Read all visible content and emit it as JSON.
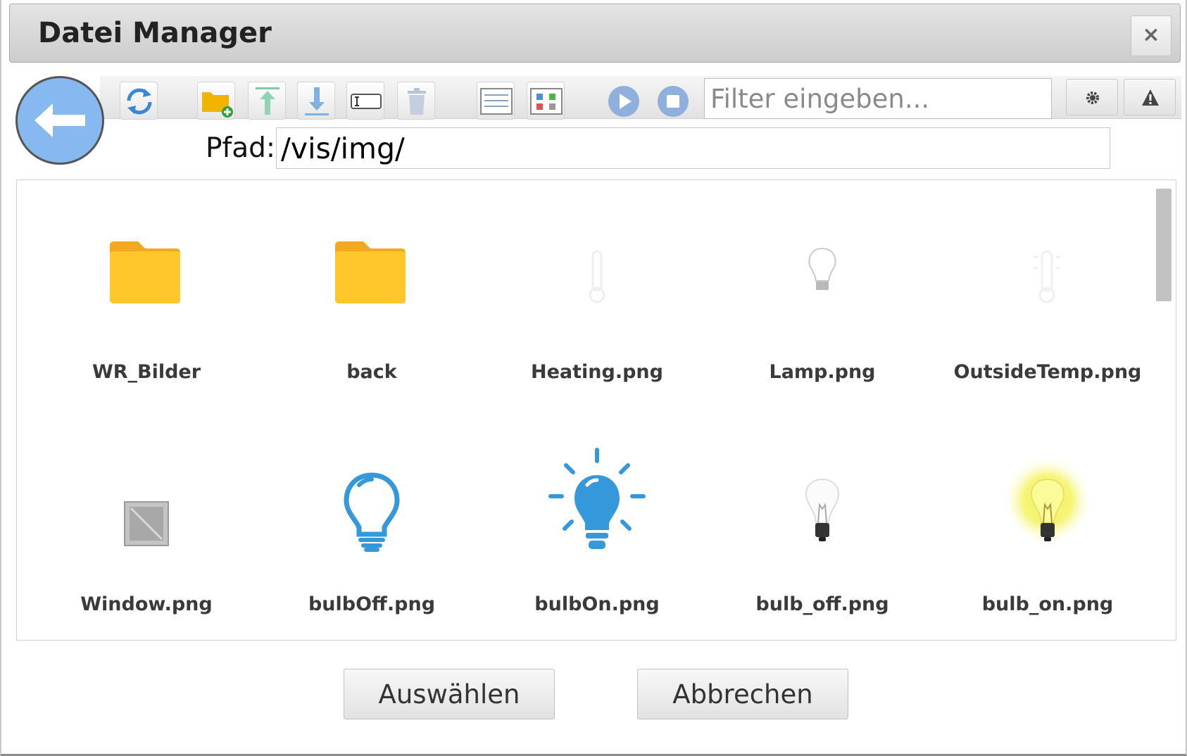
{
  "window": {
    "title": "Datei Manager",
    "close_glyph": "×"
  },
  "toolbar": {
    "icons": [
      "back-arrow-icon",
      "refresh-icon",
      "new-folder-icon",
      "upload-icon",
      "download-icon",
      "rename-icon",
      "delete-icon",
      "list-view-icon",
      "grid-view-icon",
      "play-icon",
      "stop-icon",
      "settings-icon",
      "warning-icon"
    ],
    "filter_placeholder": "Filter eingeben..."
  },
  "path": {
    "label": "Pfad:",
    "value": "/vis/img/"
  },
  "files": [
    {
      "name": "WR_Bilder",
      "icon": "folder-icon"
    },
    {
      "name": "back",
      "icon": "folder-icon"
    },
    {
      "name": "Heating.png",
      "icon": "thermometer-icon"
    },
    {
      "name": "Lamp.png",
      "icon": "lamp-icon"
    },
    {
      "name": "OutsideTemp.png",
      "icon": "outside-temp-icon"
    },
    {
      "name": "Window.png",
      "icon": "window-icon"
    },
    {
      "name": "bulbOff.png",
      "icon": "bulb-outline-icon"
    },
    {
      "name": "bulbOn.png",
      "icon": "bulb-on-icon"
    },
    {
      "name": "bulb_off.png",
      "icon": "bulb-off-icon"
    },
    {
      "name": "bulb_on.png",
      "icon": "bulb-glow-icon"
    }
  ],
  "colors": {
    "folder": "#ffc72c",
    "bulb_blue": "#3498db",
    "back_button": "#87b8f0",
    "glow": "#f3f25a"
  },
  "buttons": {
    "select": "Auswählen",
    "cancel": "Abbrechen"
  }
}
